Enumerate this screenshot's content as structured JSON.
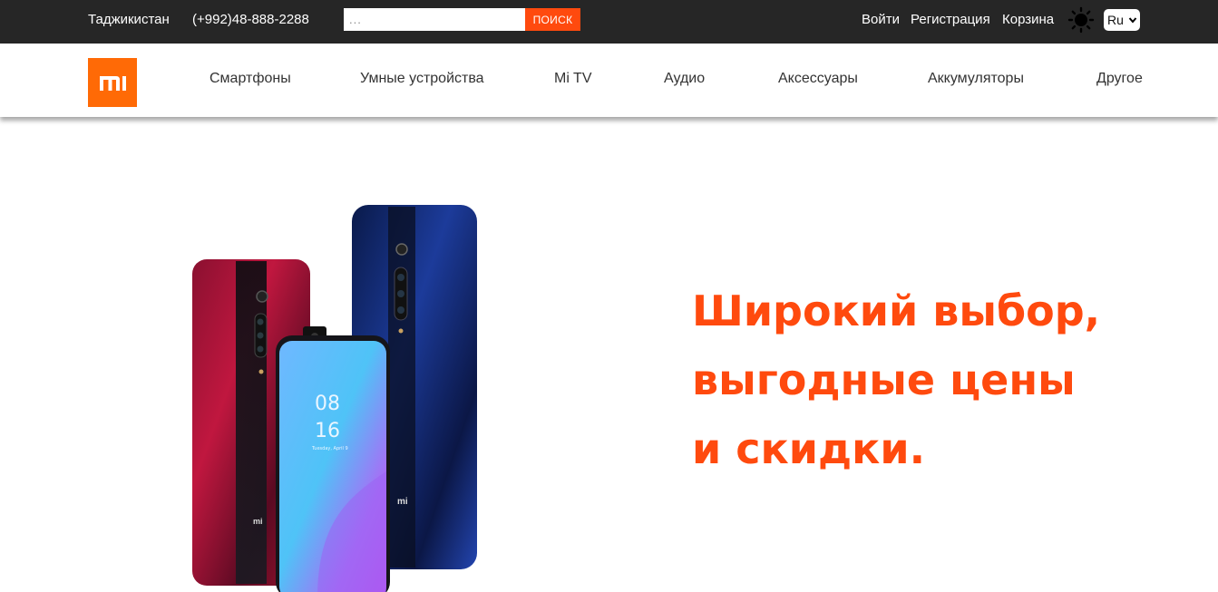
{
  "topbar": {
    "country": "Таджикистан",
    "phone": "(+992)48-888-2288",
    "search_placeholder": "...",
    "search_button": "ПОИСК",
    "login": "Войти",
    "register": "Регистрация",
    "cart": "Корзина",
    "theme_icon": "sun-icon",
    "language": "Ru"
  },
  "navbar": {
    "logo_text": "mi",
    "items": [
      {
        "label": "Смартфоны"
      },
      {
        "label": "Умные устройства"
      },
      {
        "label": "Mi TV"
      },
      {
        "label": "Аудио"
      },
      {
        "label": "Аксессуары"
      },
      {
        "label": "Аккумуляторы"
      },
      {
        "label": "Другое"
      }
    ]
  },
  "hero": {
    "headline": "Широкий выбор, выгодные цены и скидки.",
    "phone_screen_time_hour": "08",
    "phone_screen_time_minute": "16",
    "phone_screen_date": "Tuesday, April 9"
  },
  "colors": {
    "accent": "#ff4a0e",
    "logo": "#ff6a06",
    "topbar": "#262626"
  }
}
